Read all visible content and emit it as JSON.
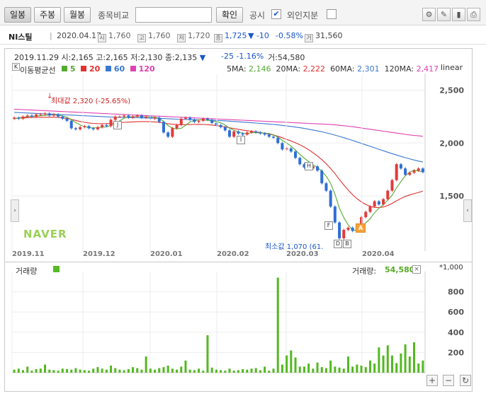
{
  "toolbar": {
    "tabs": [
      "일봉",
      "주봉",
      "월봉"
    ],
    "compare_label": "종목비교",
    "confirm_label": "확인",
    "notice_label": "공시",
    "notice_checked": "✔",
    "foreign_label": "외인지분"
  },
  "stock": {
    "name": "NI스틸",
    "date": "2020.04.17",
    "open_icon": "시",
    "open": "1,760",
    "high_icon": "고",
    "high": "1,760",
    "low_icon": "저",
    "low": "1,720",
    "close_icon": "종",
    "close": "1,725",
    "change": "▼ -10",
    "change_pct": "-0.58%",
    "volume_icon": "거",
    "volume": "31,560"
  },
  "chart_header": {
    "ohlc_line": "2019.11.29 시:2,165 고:2,165 저:2,130 종:2,135",
    "ohlc_arrow": "▼",
    "change_line": "-25  -1.16%",
    "volume_line": "거:54,580",
    "legend_title": "이동평균선",
    "legend": [
      {
        "label": "5",
        "color": "#55aa33"
      },
      {
        "label": "20",
        "color": "#e03030"
      },
      {
        "label": "60",
        "color": "#3a78d0"
      },
      {
        "label": "120",
        "color": "#e040b0"
      }
    ],
    "ma_values": [
      {
        "label": "5MA:",
        "value": "2,146",
        "color": "#55aa33"
      },
      {
        "label": "20MA:",
        "value": "2,222",
        "color": "#e03030"
      },
      {
        "label": "60MA:",
        "value": "2,301",
        "color": "#3a78d0"
      },
      {
        "label": "120MA:",
        "value": "2,417",
        "color": "#e040b0"
      }
    ],
    "scale_label": "linear",
    "k_label": "K"
  },
  "annotations": {
    "max_label": "최대값 2,320 (-25.65%)",
    "min_label": "최소값 1,070 (61.",
    "markers": [
      "J",
      "I",
      "H",
      "F",
      "D",
      "B",
      "A"
    ]
  },
  "watermark": "NAVER",
  "volume_panel": {
    "title": "거래량",
    "legend_label": "거래량:",
    "legend_value": "54,580",
    "unit": "*1,000"
  },
  "chart_data": [
    {
      "type": "candlestick",
      "y_ticks": [
        "2,500",
        "2,000",
        "1,500"
      ],
      "x_ticks": [
        "2019.11",
        "2019.12",
        "2020.01",
        "2020.02",
        "2020.03",
        "2020.04"
      ],
      "ylim": [
        1000,
        2650
      ],
      "close": [
        2240,
        2230,
        2250,
        2260,
        2250,
        2270,
        2270,
        2280,
        2260,
        2270,
        2250,
        2230,
        2210,
        2140,
        2130,
        2150,
        2160,
        2140,
        2130,
        2150,
        2170,
        2160,
        2220,
        2250,
        2250,
        2260,
        2240,
        2250,
        2260,
        2240,
        2250,
        2230,
        2240,
        2200,
        2100,
        2060,
        2140,
        2170,
        2230,
        2240,
        2220,
        2200,
        2210,
        2230,
        2220,
        2190,
        2170,
        2150,
        2120,
        2060,
        2110,
        2090,
        2080,
        2100,
        2110,
        2100,
        2090,
        2080,
        2060,
        2050,
        2000,
        1940,
        1950,
        1920,
        1860,
        1800,
        1770,
        1760,
        1780,
        1740,
        1620,
        1550,
        1400,
        1250,
        1100,
        1180,
        1200,
        1170,
        1210,
        1300,
        1350,
        1400,
        1450,
        1420,
        1470,
        1550,
        1650,
        1800,
        1760,
        1700,
        1720,
        1740,
        1760,
        1725
      ],
      "ma5": [
        2230,
        2238,
        2244,
        2250,
        2252,
        2254,
        2258,
        2262,
        2264,
        2266,
        2262,
        2256,
        2244,
        2222,
        2194,
        2172,
        2156,
        2146,
        2142,
        2146,
        2150,
        2152,
        2166,
        2186,
        2210,
        2236,
        2246,
        2250,
        2252,
        2250,
        2248,
        2246,
        2244,
        2236,
        2204,
        2166,
        2140,
        2134,
        2140,
        2168,
        2200,
        2212,
        2220,
        2220,
        2216,
        2210,
        2204,
        2192,
        2170,
        2140,
        2120,
        2106,
        2092,
        2088,
        2098,
        2098,
        2096,
        2094,
        2090,
        2078,
        2056,
        2026,
        2000,
        1972,
        1934,
        1894,
        1858,
        1826,
        1794,
        1770,
        1734,
        1686,
        1620,
        1514,
        1384,
        1296,
        1226,
        1180,
        1172,
        1212,
        1246,
        1286,
        1342,
        1384,
        1418,
        1458,
        1508,
        1578,
        1636,
        1692,
        1726,
        1744,
        1736,
        1729
      ],
      "ma20": [
        2235,
        2236,
        2238,
        2240,
        2241,
        2242,
        2243,
        2244,
        2244,
        2244,
        2242,
        2238,
        2232,
        2224,
        2214,
        2204,
        2196,
        2190,
        2186,
        2184,
        2183,
        2184,
        2186,
        2189,
        2192,
        2196,
        2198,
        2200,
        2202,
        2203,
        2203,
        2202,
        2200,
        2196,
        2190,
        2183,
        2178,
        2175,
        2174,
        2174,
        2175,
        2176,
        2177,
        2176,
        2174,
        2170,
        2165,
        2159,
        2152,
        2144,
        2137,
        2130,
        2123,
        2117,
        2112,
        2106,
        2100,
        2093,
        2085,
        2076,
        2064,
        2050,
        2035,
        2020,
        2003,
        1984,
        1962,
        1937,
        1909,
        1878,
        1843,
        1804,
        1760,
        1710,
        1656,
        1604,
        1556,
        1512,
        1474,
        1444,
        1420,
        1402,
        1392,
        1390,
        1396,
        1410,
        1430,
        1454,
        1476,
        1496,
        1510,
        1522,
        1534,
        1545
      ],
      "ma60": [
        2290,
        2288,
        2286,
        2284,
        2282,
        2280,
        2278,
        2276,
        2274,
        2272,
        2270,
        2268,
        2266,
        2264,
        2262,
        2260,
        2258,
        2256,
        2254,
        2252,
        2250,
        2248,
        2246,
        2244,
        2243,
        2242,
        2241,
        2240,
        2239,
        2238,
        2237,
        2236,
        2235,
        2234,
        2232,
        2230,
        2228,
        2226,
        2224,
        2223,
        2222,
        2221,
        2220,
        2219,
        2218,
        2216,
        2214,
        2212,
        2210,
        2207,
        2204,
        2201,
        2198,
        2195,
        2192,
        2189,
        2186,
        2183,
        2180,
        2176,
        2172,
        2167,
        2162,
        2157,
        2151,
        2145,
        2138,
        2131,
        2123,
        2115,
        2106,
        2096,
        2086,
        2075,
        2063,
        2051,
        2038,
        2025,
        2011,
        1997,
        1983,
        1969,
        1955,
        1941,
        1927,
        1913,
        1900,
        1887,
        1874,
        1862,
        1851,
        1840,
        1830,
        1821
      ],
      "ma120": [
        2320,
        2318,
        2316,
        2314,
        2312,
        2310,
        2308,
        2306,
        2304,
        2302,
        2300,
        2298,
        2296,
        2294,
        2292,
        2290,
        2288,
        2286,
        2284,
        2282,
        2280,
        2278,
        2276,
        2274,
        2272,
        2270,
        2268,
        2266,
        2264,
        2262,
        2260,
        2258,
        2256,
        2254,
        2252,
        2250,
        2248,
        2246,
        2244,
        2242,
        2240,
        2238,
        2236,
        2234,
        2232,
        2230,
        2228,
        2226,
        2224,
        2222,
        2220,
        2218,
        2216,
        2214,
        2212,
        2210,
        2208,
        2206,
        2204,
        2202,
        2200,
        2198,
        2196,
        2194,
        2192,
        2190,
        2188,
        2186,
        2184,
        2182,
        2180,
        2178,
        2175,
        2172,
        2168,
        2164,
        2159,
        2154,
        2148,
        2142,
        2136,
        2130,
        2124,
        2118,
        2112,
        2106,
        2100,
        2094,
        2088,
        2082,
        2077,
        2072,
        2068,
        2064
      ]
    },
    {
      "type": "bar",
      "y_ticks": [
        "800",
        "600",
        "400",
        "200"
      ],
      "ylim": [
        0,
        1000
      ],
      "values": [
        30,
        40,
        25,
        60,
        20,
        35,
        40,
        80,
        30,
        25,
        20,
        40,
        35,
        30,
        45,
        30,
        25,
        20,
        40,
        55,
        40,
        30,
        70,
        45,
        30,
        25,
        35,
        55,
        45,
        30,
        160,
        40,
        30,
        45,
        55,
        70,
        40,
        30,
        60,
        120,
        30,
        25,
        40,
        20,
        370,
        50,
        30,
        25,
        20,
        40,
        20,
        25,
        35,
        30,
        40,
        45,
        25,
        60,
        20,
        40,
        940,
        80,
        170,
        220,
        150,
        60,
        60,
        90,
        40,
        100,
        55,
        45,
        120,
        60,
        50,
        40,
        160,
        60,
        80,
        70,
        55,
        120,
        90,
        250,
        170,
        270,
        170,
        95,
        190,
        280,
        160,
        300,
        90,
        120
      ]
    }
  ]
}
